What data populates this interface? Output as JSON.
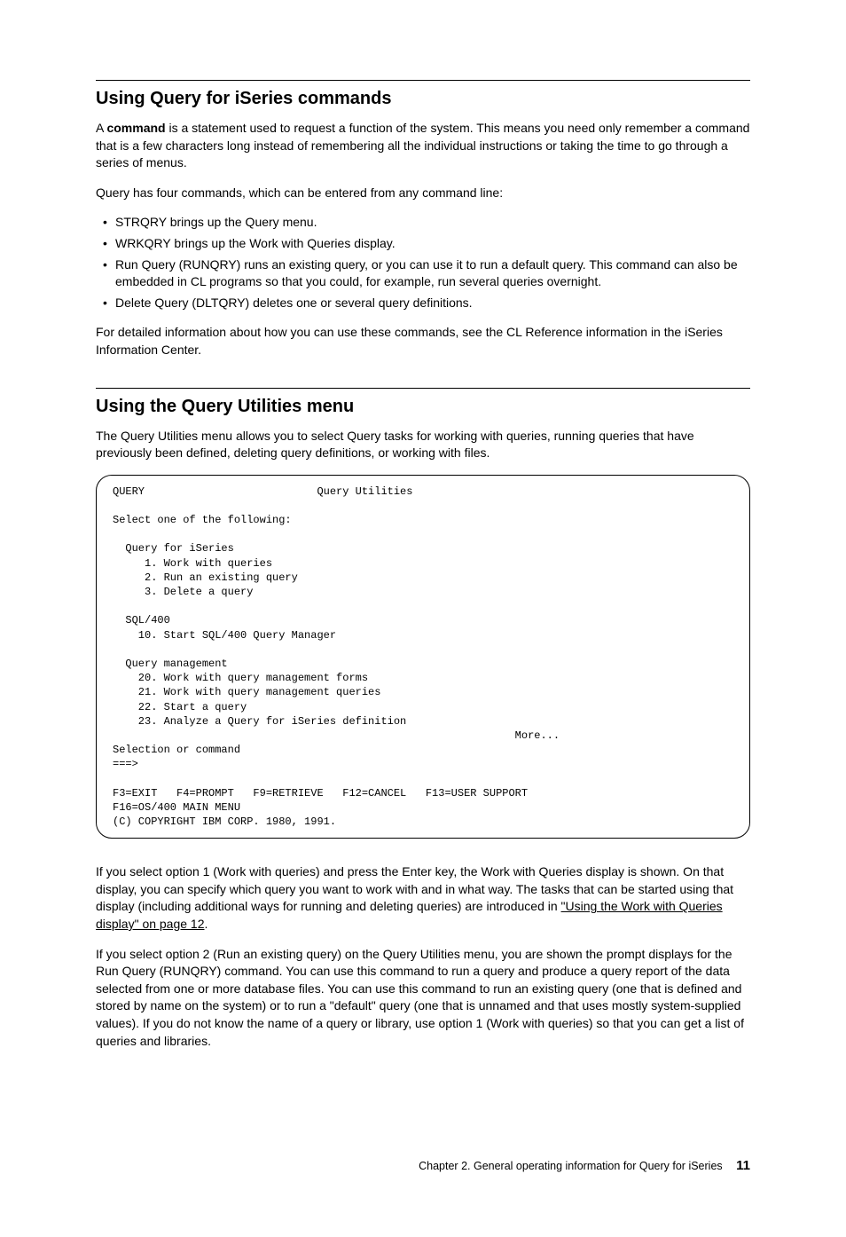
{
  "section1": {
    "heading": "Using Query for iSeries commands",
    "para1_a": "A ",
    "para1_bold": "command",
    "para1_b": " is a statement used to request a function of the system. This means you need only remember a command that is a few characters long instead of remembering all the individual instructions or taking the time to go through a series of menus.",
    "para2": "Query has four commands, which can be entered from any command line:",
    "bullets": [
      "STRQRY brings up the Query menu.",
      "WRKQRY brings up the Work with Queries display.",
      "Run Query (RUNQRY) runs an existing query, or you can use it to run a default query. This command can also be embedded in CL programs so that you could, for example, run several queries overnight.",
      "Delete Query (DLTQRY) deletes one or several query definitions."
    ],
    "para3": "For detailed information about how you can use these commands, see the CL Reference information in the iSeries Information Center."
  },
  "section2": {
    "heading": "Using the Query Utilities menu",
    "para1": "The Query Utilities menu allows you to select Query tasks for working with queries, running queries that have previously been defined, deleting query definitions, or working with files.",
    "terminal": "QUERY                           Query Utilities\n\nSelect one of the following:\n\n  Query for iSeries\n     1. Work with queries\n     2. Run an existing query\n     3. Delete a query\n\n  SQL/400\n    10. Start SQL/400 Query Manager\n\n  Query management\n    20. Work with query management forms\n    21. Work with query management queries\n    22. Start a query\n    23. Analyze a Query for iSeries definition\n                                                               More...\nSelection or command\n===>\n\nF3=EXIT   F4=PROMPT   F9=RETRIEVE   F12=CANCEL   F13=USER SUPPORT\nF16=OS/400 MAIN MENU\n(C) COPYRIGHT IBM CORP. 1980, 1991.",
    "para2_a": "If you select option 1 (Work with queries) and press the Enter key, the Work with Queries display is shown. On that display, you can specify which query you want to work with and in what way. The tasks that can be started using that display (including additional ways for running and deleting queries) are introduced in ",
    "para2_link": "\"Using the Work with Queries display\" on page 12",
    "para2_b": ".",
    "para3": "If you select option 2 (Run an existing query) on the Query Utilities menu, you are shown the prompt displays for the Run Query (RUNQRY) command. You can use this command to run a query and produce a query report of the data selected from one or more database files. You can use this command to run an existing query (one that is defined and stored by name on the system) or to run a \"default\" query (one that is unnamed and that uses mostly system-supplied values). If you do not know the name of a query or library, use option 1 (Work with queries) so that you can get a list of queries and libraries."
  },
  "footer": {
    "chapter": "Chapter 2. General operating information for Query for iSeries",
    "page": "11"
  }
}
